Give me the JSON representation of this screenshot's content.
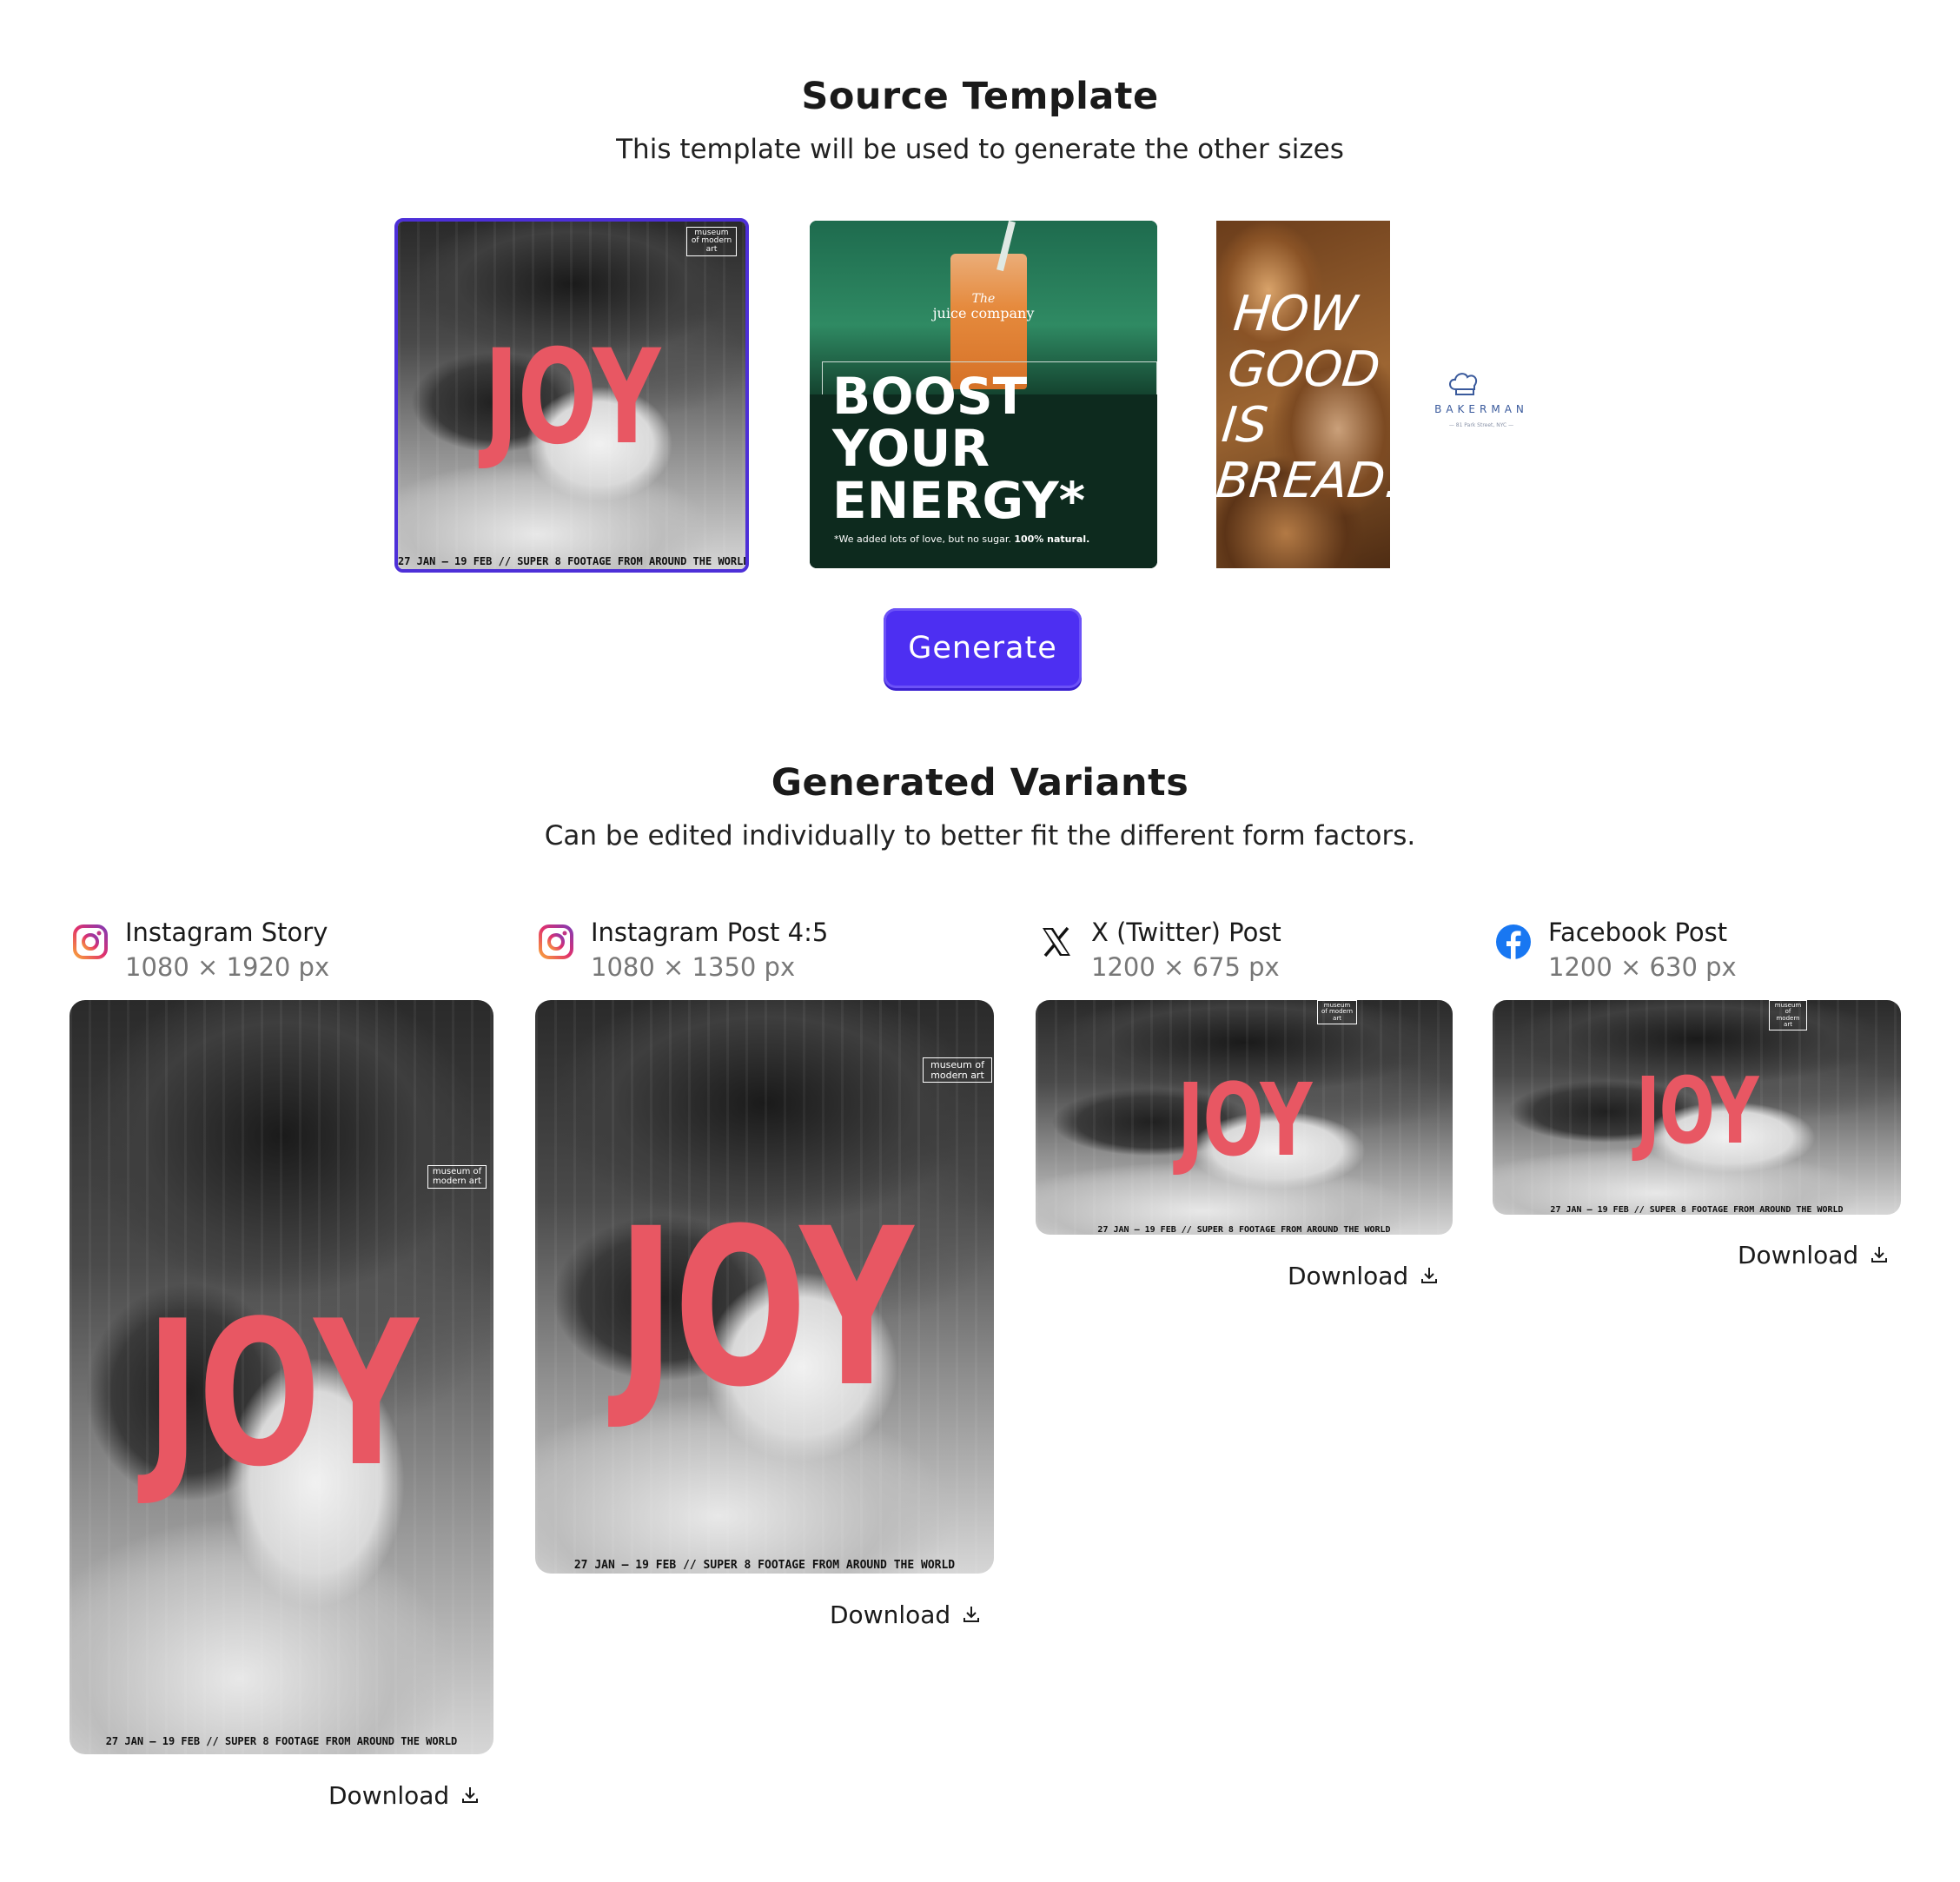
{
  "source": {
    "title": "Source Template",
    "subtitle": "This template will be used to generate the other sizes"
  },
  "templates": {
    "joy": {
      "headline": "JOY",
      "museum_label": "museum of modern art",
      "caption": "27 JAN – 19 FEB // SUPER 8 FOOTAGE FROM AROUND THE WORLD"
    },
    "juice": {
      "brand_small": "The",
      "brand": "juice company",
      "headline_lines": [
        "BOOST",
        "YOUR",
        "ENERGY*"
      ],
      "footnote": "*We added lots of love, but no sugar.",
      "footnote_bold": "100% natural."
    },
    "bread": {
      "headline_lines": [
        "HOW",
        "GOOD",
        "IS",
        "BREAD."
      ],
      "brand": "BAKERMAN",
      "address": "— 81 Park Street, NYC —"
    }
  },
  "generate_button": "Generate",
  "variants_section": {
    "title": "Generated Variants",
    "subtitle": "Can be edited individually to better fit the different form factors."
  },
  "variants": [
    {
      "name": "Instagram Story",
      "dims": "1080 × 1920 px",
      "icon": "instagram-icon",
      "download": "Download"
    },
    {
      "name": "Instagram Post 4:5",
      "dims": "1080 × 1350 px",
      "icon": "instagram-icon",
      "download": "Download"
    },
    {
      "name": "X (Twitter) Post",
      "dims": "1200 × 675 px",
      "icon": "x-twitter-icon",
      "download": "Download"
    },
    {
      "name": "Facebook Post",
      "dims": "1200 × 630 px",
      "icon": "facebook-icon",
      "download": "Download"
    }
  ],
  "colors": {
    "accent": "#4d2ff2",
    "joy_red": "#e85763",
    "juice_green": "#0d2a1e",
    "facebook_blue": "#1877f2"
  }
}
